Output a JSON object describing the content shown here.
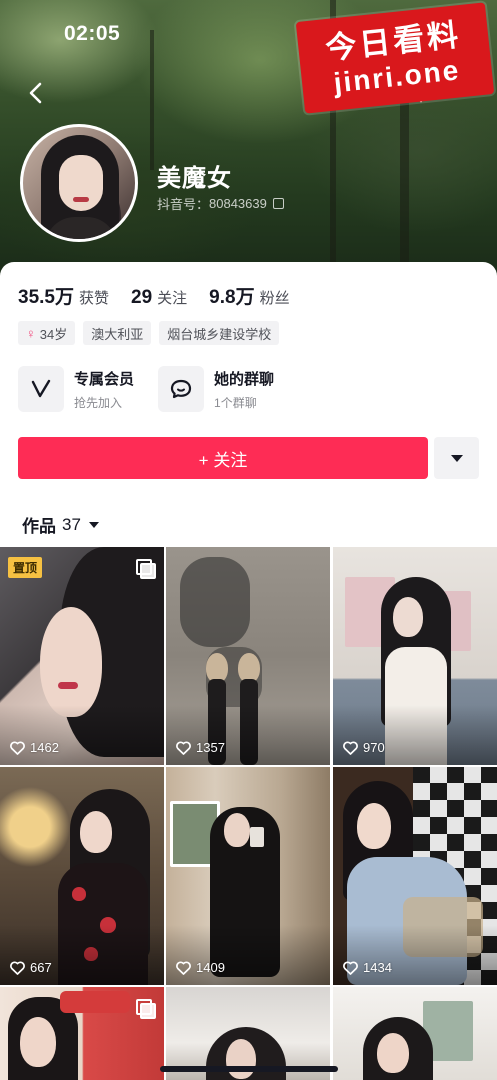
{
  "status_bar": {
    "time": "02:05"
  },
  "watermark": {
    "line1": "今日看料",
    "line2": "jinri.one"
  },
  "profile": {
    "nickname": "美魔女",
    "douyin_id_label": "抖音号：",
    "douyin_id": "80843639"
  },
  "stats": [
    {
      "value": "35.5万",
      "label": "获赞"
    },
    {
      "value": "29",
      "label": "关注"
    },
    {
      "value": "9.8万",
      "label": "粉丝"
    }
  ],
  "tags": [
    {
      "icon": "female-icon",
      "text": "34岁"
    },
    {
      "text": "澳大利亚"
    },
    {
      "text": "烟台城乡建设学校"
    }
  ],
  "entries": [
    {
      "icon": "v-icon",
      "title": "专属会员",
      "subtitle": "抢先加入"
    },
    {
      "icon": "chat-bubble-icon",
      "title": "她的群聊",
      "subtitle": "1个群聊"
    }
  ],
  "actions": {
    "follow_label": "+ 关注"
  },
  "works_tab": {
    "label": "作品",
    "count": "37"
  },
  "videos": [
    {
      "likes": "1462",
      "pinned": "置顶",
      "multi": true
    },
    {
      "likes": "1357"
    },
    {
      "likes": "970"
    },
    {
      "likes": "667"
    },
    {
      "likes": "1409"
    },
    {
      "likes": "1434"
    },
    {
      "likes": "",
      "multi": true
    },
    {
      "likes": ""
    },
    {
      "likes": ""
    }
  ],
  "colors": {
    "accent": "#fe2c55",
    "watermark": "#d9181c",
    "pin": "#f6c142"
  }
}
